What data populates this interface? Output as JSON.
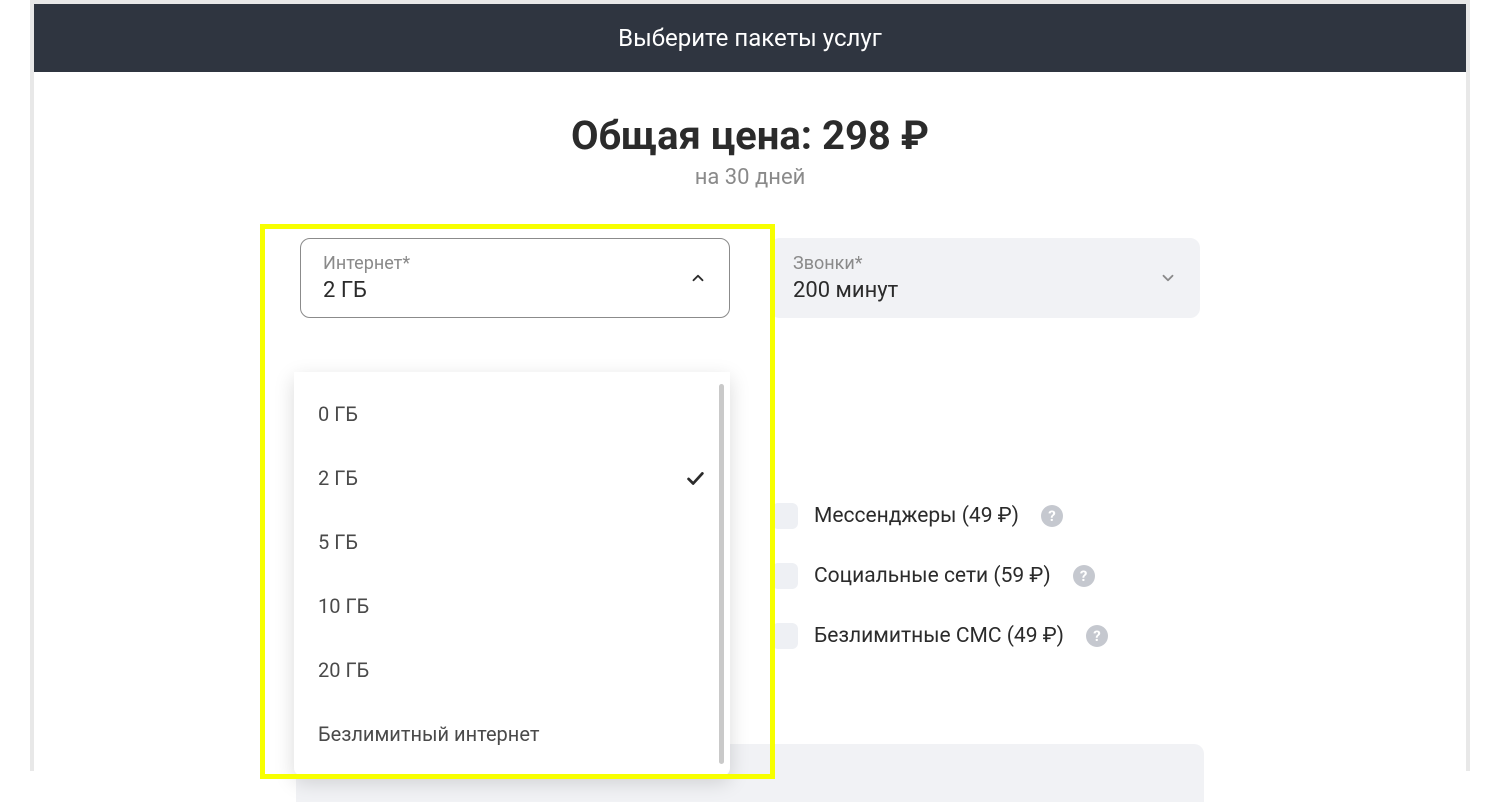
{
  "header": {
    "title": "Выберите пакеты услуг"
  },
  "price": {
    "heading": "Общая цена: 298 ₽",
    "sub": "на 30 дней"
  },
  "internet": {
    "label": "Интернет*",
    "value": "2 ГБ",
    "options": [
      {
        "label": "0 ГБ",
        "selected": false
      },
      {
        "label": "2 ГБ",
        "selected": true
      },
      {
        "label": "5 ГБ",
        "selected": false
      },
      {
        "label": "10 ГБ",
        "selected": false
      },
      {
        "label": "20 ГБ",
        "selected": false
      },
      {
        "label": "Безлимитный интернет",
        "selected": false
      }
    ]
  },
  "calls": {
    "label": "Звонки*",
    "value": "200 минут"
  },
  "addons": [
    {
      "label": "Мессенджеры (49 ₽)"
    },
    {
      "label": "Социальные сети (59 ₽)"
    },
    {
      "label": "Безлимитные СМС (49 ₽)"
    }
  ]
}
